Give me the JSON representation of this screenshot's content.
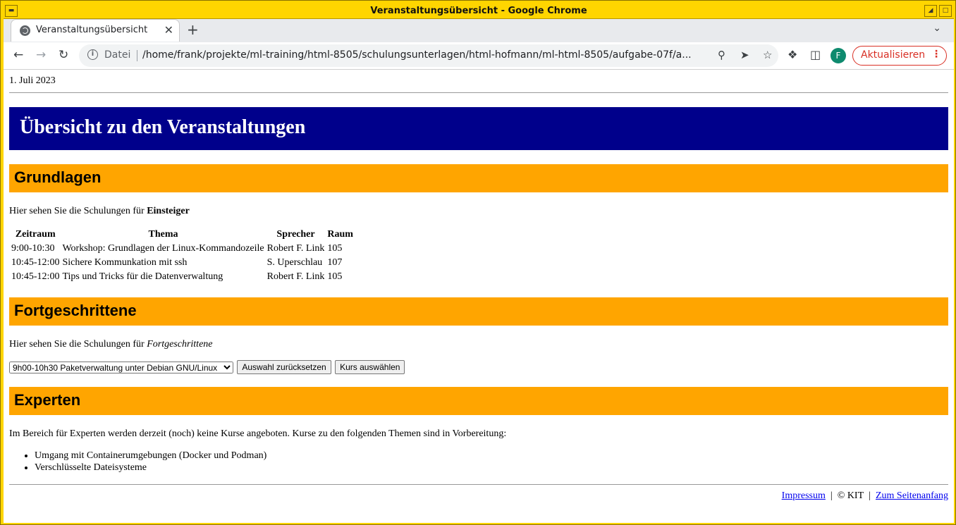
{
  "window": {
    "title": "Veranstaltungsübersicht - Google Chrome"
  },
  "browser": {
    "tab_title": "Veranstaltungsübersicht",
    "url_scheme_label": "Datei",
    "url": "/home/frank/projekte/ml-training/html-8505/schulungsunterlagen/html-hofmann/ml-html-8505/aufgabe-07f/a...",
    "profile_initial": "F",
    "update_label": "Aktualisieren"
  },
  "page": {
    "date": "1. Juli 2023",
    "banner_title": "Übersicht zu den Veranstaltungen",
    "grundlagen": {
      "heading": "Grundlagen",
      "intro_prefix": "Hier sehen Sie die Schulungen für ",
      "intro_strong": "Einsteiger",
      "columns": [
        "Zeitraum",
        "Thema",
        "Sprecher",
        "Raum"
      ],
      "rows": [
        [
          "9:00-10:30",
          "Workshop: Grundlagen der Linux-Kommandozeile",
          "Robert F. Link",
          "105"
        ],
        [
          "10:45-12:00",
          "Sichere Kommunkation mit ssh",
          "S. Uperschlau",
          "107"
        ],
        [
          "10:45-12:00",
          "Tips und Tricks für die Datenverwaltung",
          "Robert F. Link",
          "105"
        ]
      ]
    },
    "fortgeschrittene": {
      "heading": "Fortgeschrittene",
      "intro_prefix": "Hier sehen Sie die Schulungen für ",
      "intro_em": "Fortgeschrittene",
      "select_value": "9h00-10h30 Paketverwaltung unter Debian GNU/Linux",
      "reset_label": "Auswahl zurücksetzen",
      "submit_label": "Kurs auswählen"
    },
    "experten": {
      "heading": "Experten",
      "intro": "Im Bereich für Experten werden derzeit (noch) keine Kurse angeboten. Kurse zu den folgenden Themen sind in Vorbereitung:",
      "topics": [
        "Umgang mit Containerumgebungen (Docker und Podman)",
        "Verschlüsselte Dateisysteme"
      ]
    },
    "footer": {
      "impressum": "Impressum",
      "separator": "|",
      "copyright": "© KIT",
      "top_link": "Zum Seitenanfang"
    }
  }
}
